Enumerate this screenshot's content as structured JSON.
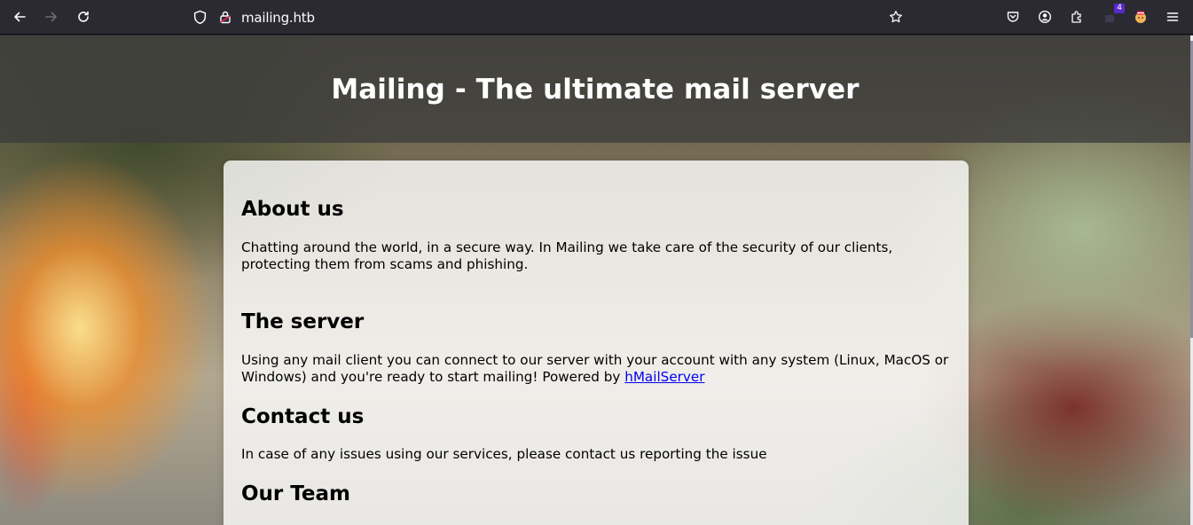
{
  "browser": {
    "url": "mailing.htb",
    "extension_badge": "4"
  },
  "page": {
    "hero_title": "Mailing - The ultimate mail server",
    "sections": {
      "about": {
        "heading": "About us",
        "text": "Chatting around the world, in a secure way. In Mailing we take care of the security of our clients, protecting them from scams and phishing."
      },
      "server": {
        "heading": "The server",
        "text": "Using any mail client you can connect to our server with your account with any system (Linux, MacOS or Windows) and you're ready to start mailing! Powered by ",
        "link_text": "hMailServer"
      },
      "contact": {
        "heading": "Contact us",
        "text": "In case of any issues using our services, please contact us reporting the issue"
      },
      "team": {
        "heading": "Our Team"
      }
    }
  },
  "colors": {
    "toolbar_bg": "#2b2a33",
    "hero_overlay": "#3c3c3c",
    "link": "#0000ee",
    "badge": "#592acb"
  },
  "icons": [
    "back-arrow-icon",
    "forward-arrow-icon",
    "reload-icon",
    "shield-icon",
    "lock-icon",
    "star-icon",
    "pocket-icon",
    "account-icon",
    "extensions-icon",
    "extension-icon",
    "profile-avatar-icon",
    "menu-icon"
  ]
}
